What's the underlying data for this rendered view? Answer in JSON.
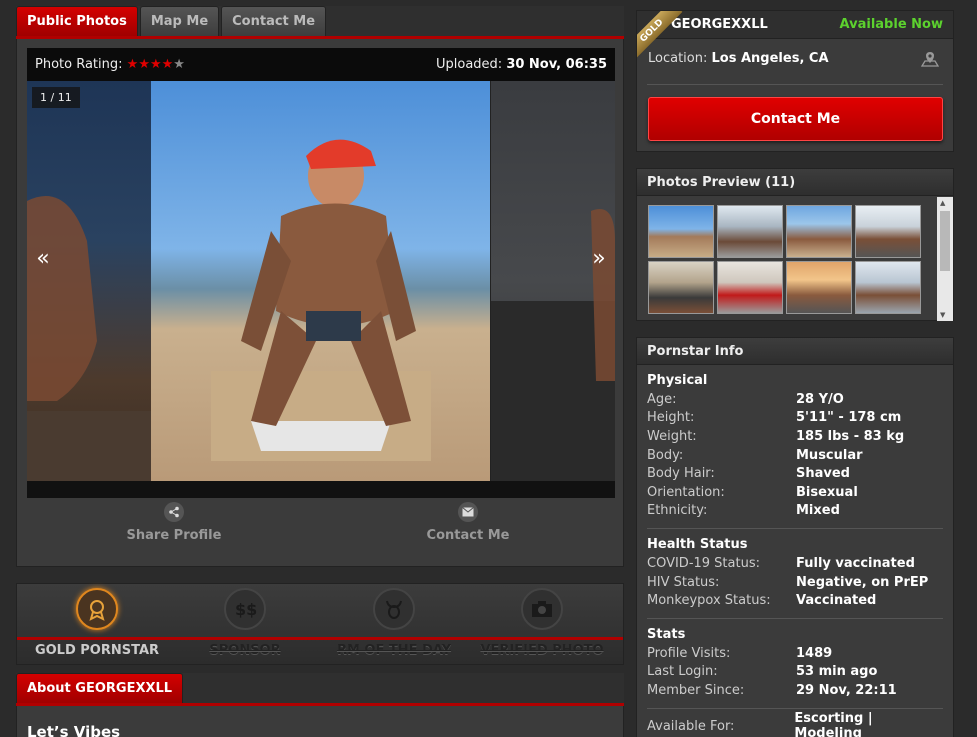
{
  "tabs": {
    "public_photos": "Public Photos",
    "map_me": "Map Me",
    "contact_me": "Contact Me"
  },
  "viewer": {
    "rating_label": "Photo Rating:",
    "rating_stars": 4,
    "rating_max": 5,
    "uploaded_label": "Uploaded:",
    "uploaded_value": "30 Nov, 06:35",
    "counter": "1 / 11",
    "prev_arrow": "«",
    "next_arrow": "»"
  },
  "actions": {
    "share": "Share Profile",
    "contact": "Contact Me"
  },
  "badges": [
    {
      "label": "GOLD PORNSTAR",
      "active": true,
      "icon": "award-icon"
    },
    {
      "label": "SPONSOR",
      "active": false,
      "icon": "dollar-icon"
    },
    {
      "label": "RM OF THE DAY",
      "active": false,
      "icon": "bull-icon"
    },
    {
      "label": "VERIFIED PHOTO",
      "active": false,
      "icon": "camera-icon"
    }
  ],
  "about": {
    "tab": "About GEORGEXXLL",
    "title": "Let’s Vibes"
  },
  "profile": {
    "ribbon": "GOLD",
    "username": "GEORGEXXLL",
    "availability": "Available Now",
    "location_label": "Location:",
    "location_value": "Los Angeles, CA",
    "contact_button": "Contact Me"
  },
  "preview": {
    "title": "Photos Preview (11)"
  },
  "info": {
    "title": "Pornstar Info",
    "physical": {
      "title": "Physical",
      "rows": [
        {
          "k": "Age:",
          "v": "28 Y/O"
        },
        {
          "k": "Height:",
          "v": "5'11\" - 178 cm"
        },
        {
          "k": "Weight:",
          "v": "185 lbs - 83 kg"
        },
        {
          "k": "Body:",
          "v": "Muscular"
        },
        {
          "k": "Body Hair:",
          "v": "Shaved"
        },
        {
          "k": "Orientation:",
          "v": "Bisexual"
        },
        {
          "k": "Ethnicity:",
          "v": "Mixed"
        }
      ]
    },
    "health": {
      "title": "Health Status",
      "rows": [
        {
          "k": "COVID-19 Status:",
          "v": "Fully vaccinated"
        },
        {
          "k": "HIV Status:",
          "v": "Negative, on PrEP"
        },
        {
          "k": "Monkeypox Status:",
          "v": "Vaccinated"
        }
      ]
    },
    "stats": {
      "title": "Stats",
      "rows": [
        {
          "k": "Profile Visits:",
          "v": "1489"
        },
        {
          "k": "Last Login:",
          "v": "53 min ago"
        },
        {
          "k": "Member Since:",
          "v": "29 Nov, 22:11"
        }
      ]
    },
    "available": {
      "k": "Available For:",
      "v": "Escorting | Modeling"
    }
  },
  "colors": {
    "accent_red": "#c00000",
    "available_green": "#5cd12e",
    "gold": "#e0871e"
  }
}
